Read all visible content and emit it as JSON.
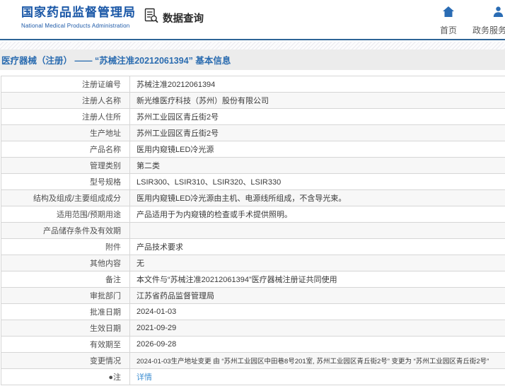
{
  "header": {
    "site_title": "国家药品监督管理局",
    "site_subtitle": "National Medical Products Administration",
    "section_title": "数据查询",
    "nav": [
      {
        "label": "首页",
        "icon": "home-icon"
      },
      {
        "label": "政务服务门户",
        "icon": "user-icon"
      }
    ]
  },
  "breadcrumb": {
    "text": "医疗器械（注册） —— “苏械注准20212061394” 基本信息"
  },
  "colors": {
    "brand_blue": "#1b58a7",
    "nav_icon_blue": "#2a6cb4",
    "header_border": "#2e6496",
    "breadcrumb_bg": "#ececec",
    "breadcrumb_text": "#2b6cb0",
    "row_alt_bg": "#f7f7f7",
    "row_border": "#d6d6d6",
    "link_blue": "#3f8fd2"
  },
  "table": {
    "rows": [
      {
        "label": "注册证编号",
        "value": "苏械注准20212061394"
      },
      {
        "label": "注册人名称",
        "value": "新光维医疗科技（苏州）股份有限公司"
      },
      {
        "label": "注册人住所",
        "value": "苏州工业园区青丘街2号"
      },
      {
        "label": "生产地址",
        "value": "苏州工业园区青丘街2号"
      },
      {
        "label": "产品名称",
        "value": "医用内窥镜LED冷光源"
      },
      {
        "label": "管理类别",
        "value": "第二类"
      },
      {
        "label": "型号规格",
        "value": "LSIR300、LSIR310、LSIR320、LSIR330"
      },
      {
        "label": "结构及组成/主要组成成分",
        "value": "医用内窥镜LED冷光源由主机、电源线所组成，不含导光束。"
      },
      {
        "label": "适用范围/预期用途",
        "value": "产品适用于为内窥镜的检查或手术提供照明。"
      },
      {
        "label": "产品储存条件及有效期",
        "value": ""
      },
      {
        "label": "附件",
        "value": "产品技术要求"
      },
      {
        "label": "其他内容",
        "value": "无"
      },
      {
        "label": "备注",
        "value": "本文件与“苏械注准20212061394”医疗器械注册证共同使用"
      },
      {
        "label": "审批部门",
        "value": "江苏省药品监督管理局"
      },
      {
        "label": "批准日期",
        "value": "2024-01-03"
      },
      {
        "label": "生效日期",
        "value": "2021-09-29"
      },
      {
        "label": "有效期至",
        "value": "2026-09-28"
      },
      {
        "label": "变更情况",
        "value": "2024-01-03生产地址变更 由 “苏州工业园区中田巷8号201室, 苏州工业园区青丘街2号” 变更为 “苏州工业园区青丘街2号”"
      },
      {
        "label": "●注",
        "value": "详情",
        "link": true
      }
    ]
  }
}
